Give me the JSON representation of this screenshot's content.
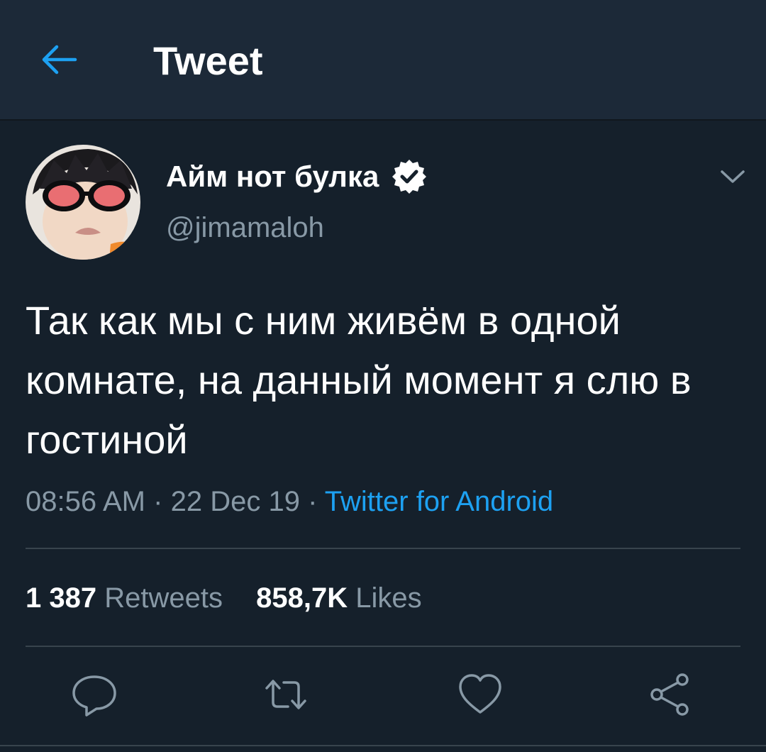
{
  "header": {
    "title": "Tweet",
    "back_icon": "arrow-left-icon",
    "background": "#1c2938"
  },
  "tweet": {
    "author": {
      "name": "Айм нот булка",
      "handle": "@jimamaloh",
      "verified": true,
      "avatar": "profile-photo"
    },
    "text": "Так как мы с ним живём в одной комнате, на данный момент я слю в гостиной",
    "time": "08:56 AM",
    "separator": "·",
    "date": "22 Dec 19",
    "source": "Twitter for Android",
    "stats": {
      "retweets_count": "1 387",
      "retweets_label": "Retweets",
      "likes_count": "858,7K",
      "likes_label": "Likes"
    }
  },
  "actions": [
    {
      "icon": "reply-icon"
    },
    {
      "icon": "retweet-icon"
    },
    {
      "icon": "like-icon"
    },
    {
      "icon": "share-icon"
    }
  ],
  "colors": {
    "background": "#15202b",
    "accent": "#1da1f2",
    "secondary_text": "#8899a6",
    "divider": "#38444d"
  }
}
